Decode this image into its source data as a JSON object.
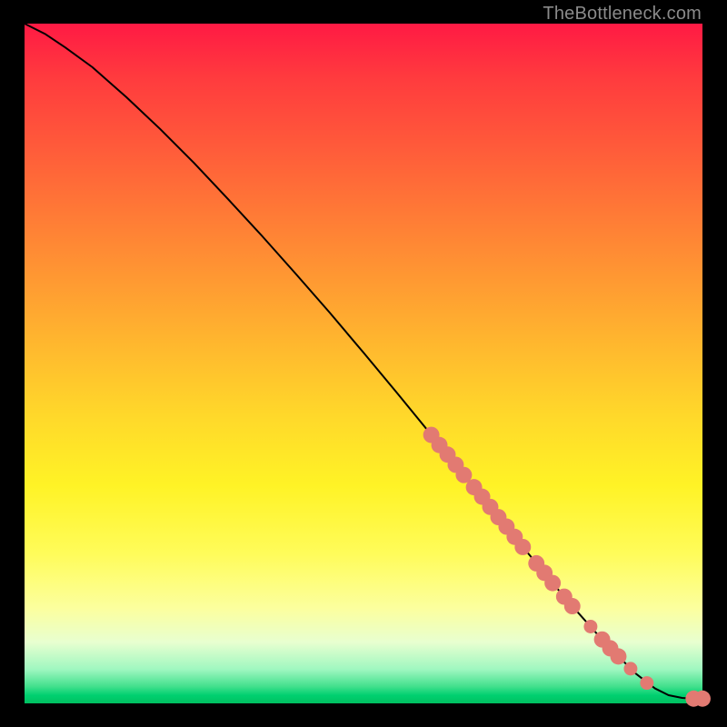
{
  "watermark": "TheBottleneck.com",
  "colors": {
    "marker": "#e27a72",
    "curve": "#000000",
    "page_bg": "#000000"
  },
  "chart_data": {
    "type": "line",
    "title": "",
    "xlabel": "",
    "ylabel": "",
    "xlim": [
      0,
      100
    ],
    "ylim": [
      0,
      100
    ],
    "grid": false,
    "series": [
      {
        "name": "curve",
        "x": [
          0,
          3,
          6,
          10,
          15,
          20,
          25,
          30,
          35,
          40,
          45,
          50,
          55,
          60,
          65,
          70,
          75,
          80,
          85,
          90,
          93,
          95,
          97,
          98.5,
          100
        ],
        "y": [
          100,
          98.5,
          96.5,
          93.6,
          89.2,
          84.5,
          79.5,
          74.2,
          68.8,
          63.2,
          57.5,
          51.6,
          45.6,
          39.5,
          33.4,
          27.3,
          21.2,
          15.2,
          9.6,
          4.5,
          2.2,
          1.2,
          0.8,
          0.7,
          0.7
        ]
      }
    ],
    "markers": [
      {
        "x": 60.0,
        "y": 39.5,
        "r": 1.2
      },
      {
        "x": 61.2,
        "y": 38.0,
        "r": 1.2
      },
      {
        "x": 62.4,
        "y": 36.6,
        "r": 1.2
      },
      {
        "x": 63.6,
        "y": 35.1,
        "r": 1.2
      },
      {
        "x": 64.8,
        "y": 33.6,
        "r": 1.2
      },
      {
        "x": 66.3,
        "y": 31.8,
        "r": 1.2
      },
      {
        "x": 67.5,
        "y": 30.4,
        "r": 1.2
      },
      {
        "x": 68.7,
        "y": 28.9,
        "r": 1.2
      },
      {
        "x": 69.9,
        "y": 27.4,
        "r": 1.2
      },
      {
        "x": 71.1,
        "y": 26.0,
        "r": 1.2
      },
      {
        "x": 72.3,
        "y": 24.5,
        "r": 1.2
      },
      {
        "x": 73.5,
        "y": 23.0,
        "r": 1.2
      },
      {
        "x": 75.5,
        "y": 20.6,
        "r": 1.2
      },
      {
        "x": 76.7,
        "y": 19.2,
        "r": 1.2
      },
      {
        "x": 77.9,
        "y": 17.7,
        "r": 1.2
      },
      {
        "x": 79.6,
        "y": 15.7,
        "r": 1.2
      },
      {
        "x": 80.8,
        "y": 14.3,
        "r": 1.2
      },
      {
        "x": 83.5,
        "y": 11.3,
        "r": 1.0
      },
      {
        "x": 85.2,
        "y": 9.4,
        "r": 1.2
      },
      {
        "x": 86.4,
        "y": 8.1,
        "r": 1.2
      },
      {
        "x": 87.6,
        "y": 6.9,
        "r": 1.2
      },
      {
        "x": 89.4,
        "y": 5.1,
        "r": 1.0
      },
      {
        "x": 91.8,
        "y": 3.0,
        "r": 1.0
      },
      {
        "x": 98.7,
        "y": 0.7,
        "r": 1.2
      },
      {
        "x": 100.0,
        "y": 0.7,
        "r": 1.2
      }
    ],
    "background_gradient": {
      "direction": "top-to-bottom",
      "stops": [
        {
          "pos": 0.0,
          "color": "#ff1a44"
        },
        {
          "pos": 0.5,
          "color": "#ffd92a"
        },
        {
          "pos": 0.8,
          "color": "#fffc5a"
        },
        {
          "pos": 0.96,
          "color": "#43e08d"
        },
        {
          "pos": 1.0,
          "color": "#00c060"
        }
      ]
    }
  }
}
